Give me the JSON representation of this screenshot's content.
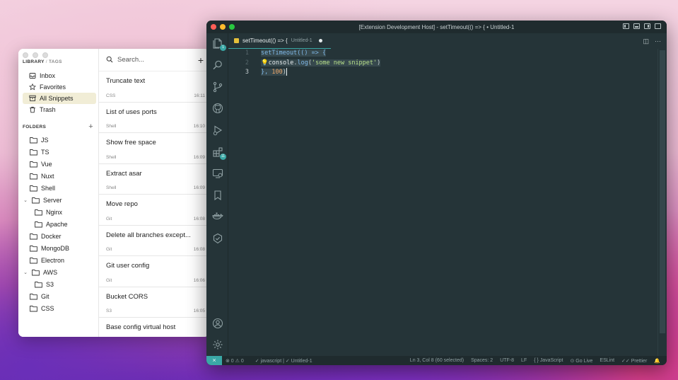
{
  "masscode": {
    "library_head": {
      "library": "LIBRARY",
      "sep": "/",
      "tags": "TAGS"
    },
    "library_items": [
      {
        "label": "Inbox",
        "icon": "inbox-icon"
      },
      {
        "label": "Favorites",
        "icon": "star-icon"
      },
      {
        "label": "All Snippets",
        "icon": "archive-icon",
        "active": true
      },
      {
        "label": "Trash",
        "icon": "trash-icon"
      }
    ],
    "folders_head": "FOLDERS",
    "folders_add": "+",
    "folders": [
      {
        "label": "JS",
        "level": 0
      },
      {
        "label": "TS",
        "level": 0
      },
      {
        "label": "Vue",
        "level": 0
      },
      {
        "label": "Nuxt",
        "level": 0
      },
      {
        "label": "Shell",
        "level": 0
      },
      {
        "label": "Server",
        "level": 0,
        "expanded": true
      },
      {
        "label": "Nginx",
        "level": 1
      },
      {
        "label": "Apache",
        "level": 1
      },
      {
        "label": "Docker",
        "level": 0
      },
      {
        "label": "MongoDB",
        "level": 0
      },
      {
        "label": "Electron",
        "level": 0
      },
      {
        "label": "AWS",
        "level": 0,
        "expanded": true
      },
      {
        "label": "S3",
        "level": 1
      },
      {
        "label": "Git",
        "level": 0
      },
      {
        "label": "CSS",
        "level": 0
      }
    ],
    "search": {
      "placeholder": "Search...",
      "add": "+"
    },
    "snippets": [
      {
        "name": "Truncate text",
        "lang": "CSS",
        "time": "16:11"
      },
      {
        "name": "List of uses ports",
        "lang": "Shell",
        "time": "16:10"
      },
      {
        "name": "Show free space",
        "lang": "Shell",
        "time": "16:09"
      },
      {
        "name": "Extract asar",
        "lang": "Shell",
        "time": "16:09"
      },
      {
        "name": "Move repo",
        "lang": "Git",
        "time": "16:08"
      },
      {
        "name": "Delete all branches except...",
        "lang": "Git",
        "time": "16:08"
      },
      {
        "name": "Git user config",
        "lang": "Git",
        "time": "16:06"
      },
      {
        "name": "Bucket CORS",
        "lang": "S3",
        "time": "16:05"
      },
      {
        "name": "Base config virtual host",
        "lang": "",
        "time": ""
      }
    ]
  },
  "vscode": {
    "title": "[Extension Development Host] - setTimeout(() => { • Untitled-1",
    "tab": {
      "name": "setTimeout(() => {",
      "desc": "Untitled-1"
    },
    "tab_actions": [
      "◫",
      "···"
    ],
    "line_numbers": [
      "1",
      "2",
      "3"
    ],
    "code": {
      "l1_fn": "setTimeout",
      "l1_rest": "(() => {",
      "l2_bulb": "💡",
      "l2_obj": "console",
      "l2_dot": ".",
      "l2_method": "log",
      "l2_open": "(",
      "l2_str": "'some new snippet'",
      "l2_close": ")",
      "l3_a": "}, ",
      "l3_num": "100",
      "l3_b": ")"
    },
    "activity_badges": {
      "explorer": "1",
      "extensions": "11"
    },
    "status": {
      "remote": "⨯",
      "errors": "⊗ 0 ⚠ 0",
      "lang_file": "✓ javascript | ✓ Untitled-1",
      "position": "Ln 3, Col 8 (60 selected)",
      "spaces": "Spaces: 2",
      "encoding": "UTF-8",
      "eol": "LF",
      "language": "{ } JavaScript",
      "golive": "⊙ Go Live",
      "eslint": "ESLint",
      "prettier": "✓✓ Prettier",
      "bell": "🔔"
    }
  }
}
